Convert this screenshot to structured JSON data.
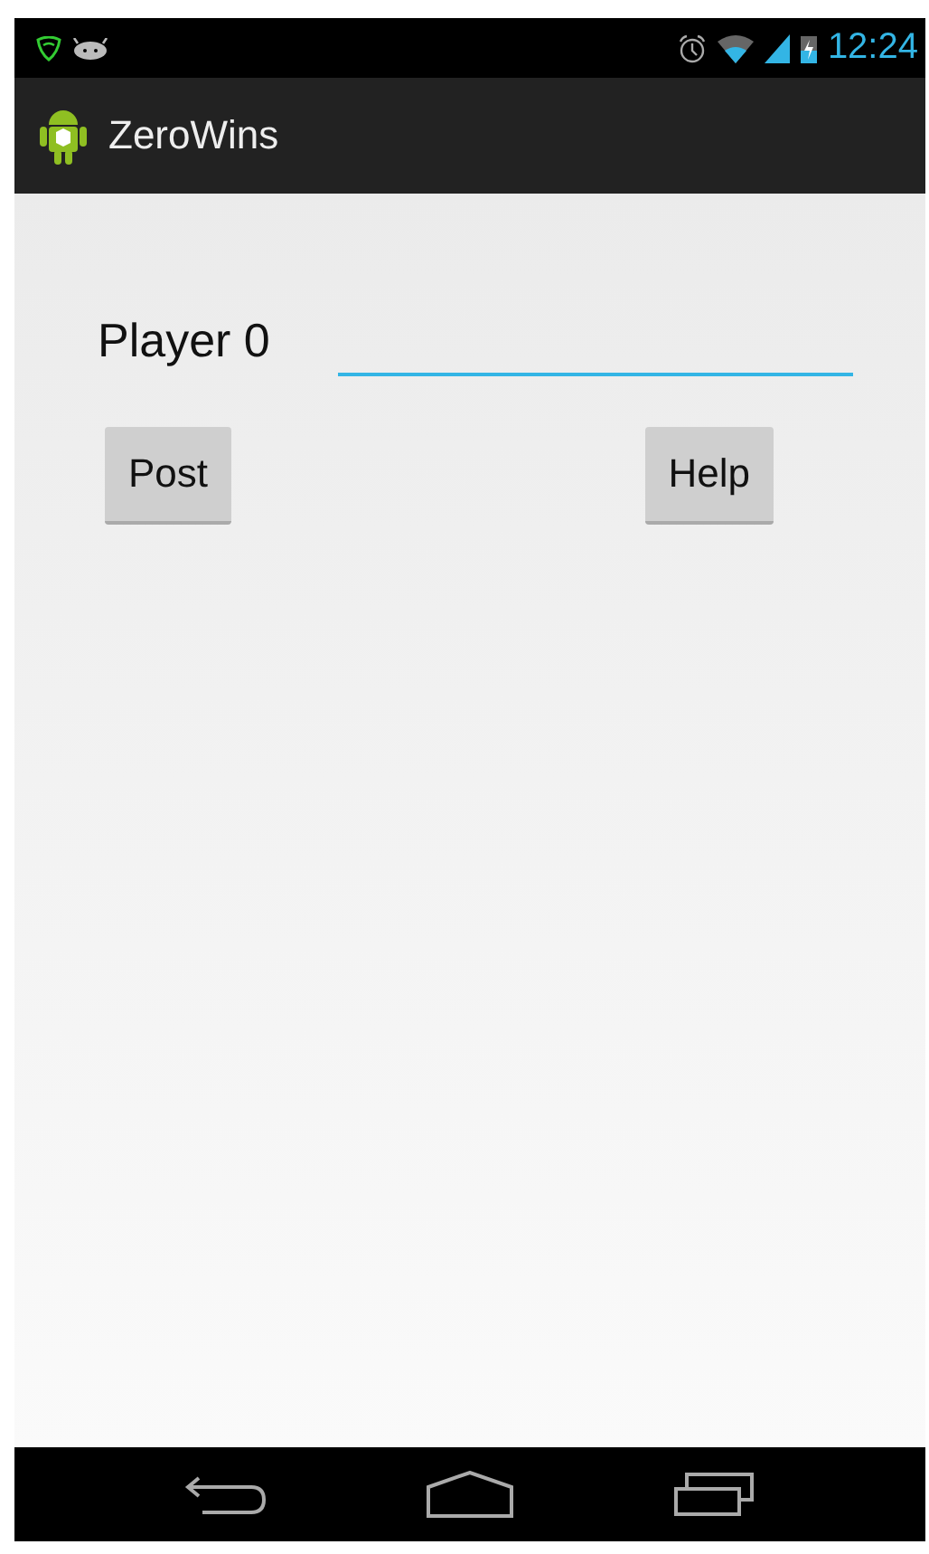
{
  "status_bar": {
    "time": "12:24"
  },
  "action_bar": {
    "title": "ZeroWins"
  },
  "form": {
    "label": "Player 0"
  },
  "buttons": [
    {
      "label": "Post"
    },
    {
      "label": "Help"
    }
  ]
}
